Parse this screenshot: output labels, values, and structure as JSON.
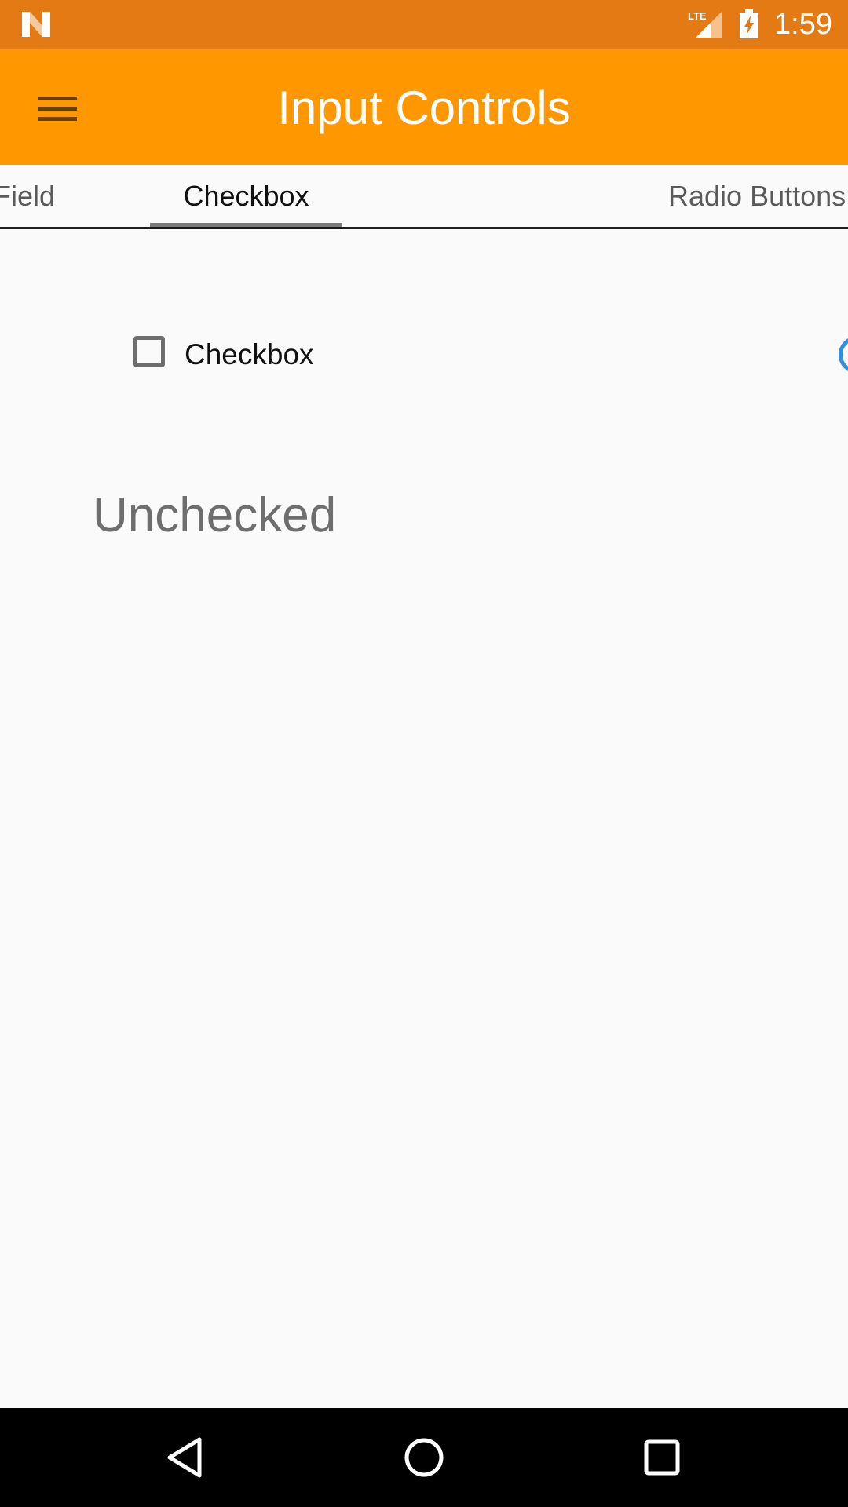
{
  "status_bar": {
    "time": "1:59",
    "network": "LTE",
    "icons": [
      "n-logo-icon",
      "lte-signal-icon",
      "battery-charging-icon"
    ],
    "color": "#e47a14"
  },
  "app_bar": {
    "title": "Input Controls",
    "menu_icon": "hamburger-menu-icon",
    "color": "#ff9800"
  },
  "tabs": [
    {
      "label": "Field",
      "active": false
    },
    {
      "label": "Checkbox",
      "active": true
    },
    {
      "label": "Radio Buttons",
      "active": false
    }
  ],
  "content": {
    "checkbox_label": "Checkbox",
    "checkbox_checked": false,
    "state_text": "Unchecked",
    "radio_accent_color": "#2f8fe0"
  },
  "nav_bar": {
    "icons": [
      "back-icon",
      "home-icon",
      "recents-icon"
    ]
  }
}
